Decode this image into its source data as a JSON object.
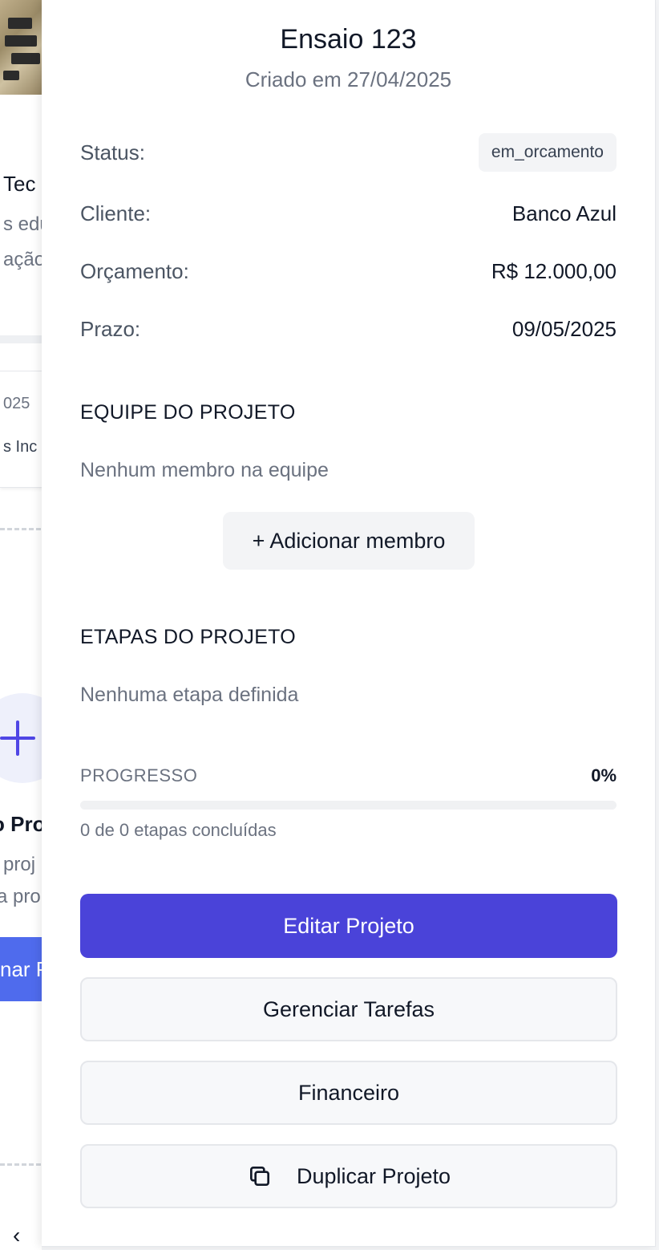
{
  "background": {
    "texts": {
      "heading_fragment": "Tec",
      "desc_line1": "s edu",
      "desc_line2": "ação",
      "date_fragment": "025",
      "client_fragment": "s Inc",
      "new_title_fragment": "o Pro",
      "new_desc_line1": "proj",
      "new_desc_line2": "a pro",
      "button_fragment": "nar P"
    },
    "prev_icon": "chevron-left-icon",
    "plus_icon": "plus-icon"
  },
  "panel": {
    "title": "Ensaio 123",
    "subtitle": "Criado em 27/04/2025",
    "details": {
      "status_label": "Status:",
      "status_value": "em_orcamento",
      "client_label": "Cliente:",
      "client_value": "Banco Azul",
      "budget_label": "Orçamento:",
      "budget_value": "R$ 12.000,00",
      "deadline_label": "Prazo:",
      "deadline_value": "09/05/2025"
    },
    "team": {
      "heading": "EQUIPE DO PROJETO",
      "empty_text": "Nenhum membro na equipe",
      "add_button": "+ Adicionar membro"
    },
    "stages": {
      "heading": "ETAPAS DO PROJETO",
      "empty_text": "Nenhuma etapa definida"
    },
    "progress": {
      "label": "PROGRESSO",
      "value_text": "0%",
      "fraction": 0,
      "caption": "0 de 0 etapas concluídas"
    },
    "actions": {
      "edit": "Editar Projeto",
      "tasks": "Gerenciar Tarefas",
      "finance": "Financeiro",
      "duplicate": "Duplicar Projeto",
      "duplicate_icon": "copy-icon"
    }
  },
  "colors": {
    "primary": "#4a43d9",
    "muted_text": "#6b7280",
    "badge_bg": "#f3f4f6"
  }
}
